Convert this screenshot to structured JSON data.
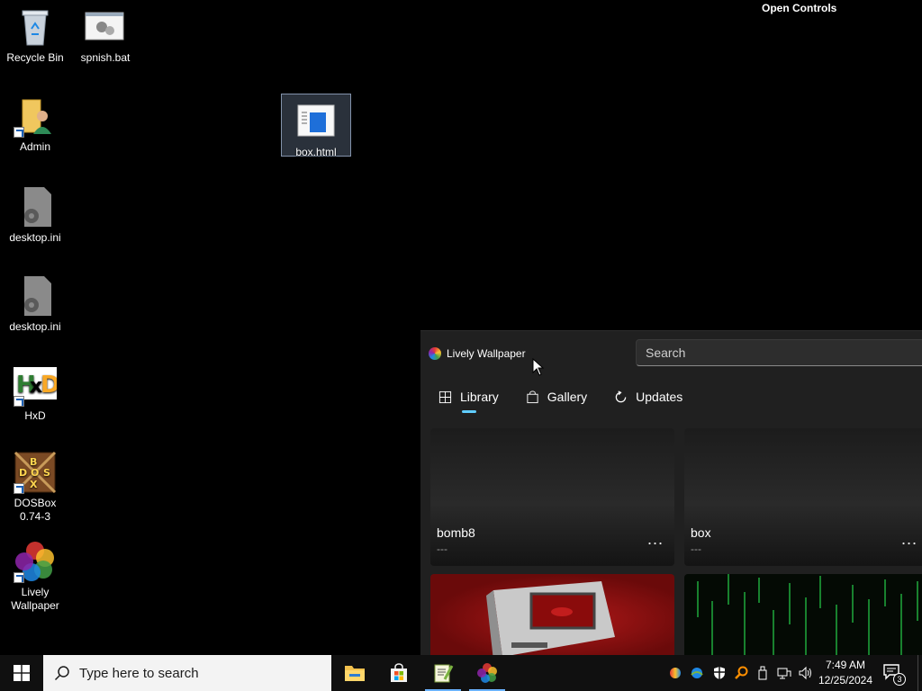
{
  "desktop": {
    "open_controls": "Open Controls",
    "icons": [
      {
        "label": "Recycle Bin"
      },
      {
        "label": "spnish.bat"
      },
      {
        "label": "Admin"
      },
      {
        "label": "box.html"
      },
      {
        "label": "desktop.ini"
      },
      {
        "label": "desktop.ini"
      },
      {
        "label": "HxD"
      },
      {
        "label": "DOSBox 0.74-3"
      },
      {
        "label": "Lively Wallpaper"
      }
    ]
  },
  "lively": {
    "title": "Lively Wallpaper",
    "search_placeholder": "Search",
    "tabs": [
      {
        "label": "Library",
        "active": true
      },
      {
        "label": "Gallery",
        "active": false
      },
      {
        "label": "Updates",
        "active": false
      }
    ],
    "cards": [
      {
        "title": "bomb8",
        "desc": "---",
        "more": "..."
      },
      {
        "title": "box",
        "desc": "---",
        "more": "..."
      }
    ]
  },
  "taskbar": {
    "search_placeholder": "Type here to search",
    "apps": [
      "file-explorer-icon",
      "microsoft-store-icon",
      "notepad-plus-icon",
      "lively-wallpaper-icon"
    ],
    "time": "7:49 AM",
    "date": "12/25/2024",
    "notification_count": "3"
  },
  "colors": {
    "accent": "#60cdff",
    "window_bg": "#202020",
    "taskbar_bg": "#101010"
  }
}
